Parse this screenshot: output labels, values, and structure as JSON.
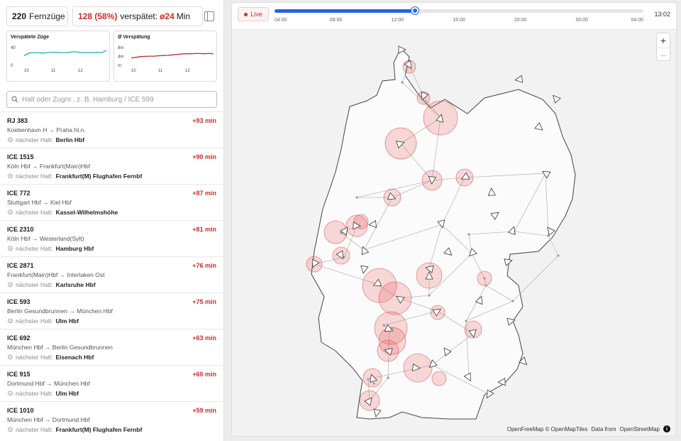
{
  "stats": {
    "total_count": "220",
    "total_label": "Fernzüge",
    "late_count": "128 (58%)",
    "late_label": "verspätet:",
    "avg_delay": "ø24",
    "avg_unit": "Min"
  },
  "charts": {
    "late_trains": {
      "title": "Verspätete Züge",
      "y_ticks": [
        "40",
        "0"
      ],
      "x_ticks": [
        "10",
        "11",
        "12"
      ],
      "series_color": "#17b5ad",
      "values": [
        20,
        26,
        27,
        27,
        26,
        27,
        28,
        28,
        27,
        27,
        28,
        29,
        28,
        27,
        27,
        27,
        28,
        27,
        32
      ]
    },
    "avg_delay": {
      "title": "Ø Verspätung",
      "y_ticks": [
        "8m",
        "4m",
        "m"
      ],
      "x_ticks": [
        "10",
        "11",
        "12"
      ],
      "series_color": "#c62828",
      "values": [
        3.0,
        3.3,
        3.6,
        3.7,
        3.8,
        3.8,
        4.0,
        4.1,
        4.2,
        4.4,
        4.6,
        4.8,
        4.9,
        4.9,
        5.0,
        5.0,
        4.9,
        5.1,
        4.8
      ]
    }
  },
  "search": {
    "placeholder": "Halt oder Zugnr., z. B. Hamburg / ICE 599"
  },
  "next_stop_label": "nächster Halt:",
  "trains": [
    {
      "name": "RJ 383",
      "route": "Koebenhavn H → Praha hl.n.",
      "next": "Berlin Hbf",
      "delay": "+93 min"
    },
    {
      "name": "ICE 1515",
      "route": "Köln Hbf → Frankfurt(Main)Hbf",
      "next": "Frankfurt(M) Flughafen Fernbf",
      "delay": "+90 min"
    },
    {
      "name": "ICE 772",
      "route": "Stuttgart Hbf → Kiel Hbf",
      "next": "Kassel-Wilhelmshöhe",
      "delay": "+87 min"
    },
    {
      "name": "ICE 2310",
      "route": "Köln Hbf → Westerland(Sylt)",
      "next": "Hamburg Hbf",
      "delay": "+81 min"
    },
    {
      "name": "ICE 2871",
      "route": "Frankfurt(Main)Hbf → Interlaken Ost",
      "next": "Karlsruhe Hbf",
      "delay": "+76 min"
    },
    {
      "name": "ICE 593",
      "route": "Berlin Gesundbrunnen → München Hbf",
      "next": "Ulm Hbf",
      "delay": "+75 min"
    },
    {
      "name": "ICE 692",
      "route": "München Hbf → Berlin Gesundbrunnen",
      "next": "Eisenach Hbf",
      "delay": "+63 min"
    },
    {
      "name": "ICE 915",
      "route": "Dortmund Hbf → München Hbf",
      "next": "Ulm Hbf",
      "delay": "+60 min"
    },
    {
      "name": "ICE 1010",
      "route": "München Hbf → Dortmund Hbf",
      "next": "Frankfurt(M) Flughafen Fernbf",
      "delay": "+59 min"
    }
  ],
  "timeline": {
    "live_label": "Live",
    "ticks": [
      "04:00",
      "08:00",
      "12:00",
      "16:00",
      "20:00",
      "00:00",
      "04:00"
    ],
    "progress": 0.38,
    "current_time": "13:02",
    "accent_color": "#2563eb"
  },
  "map": {
    "zoom_in": "+",
    "zoom_out": "−",
    "attribution_a": "OpenFreeMap © OpenMapTiles",
    "attribution_b": "Data from",
    "attribution_c": "OpenStreetMap",
    "info": "i"
  }
}
